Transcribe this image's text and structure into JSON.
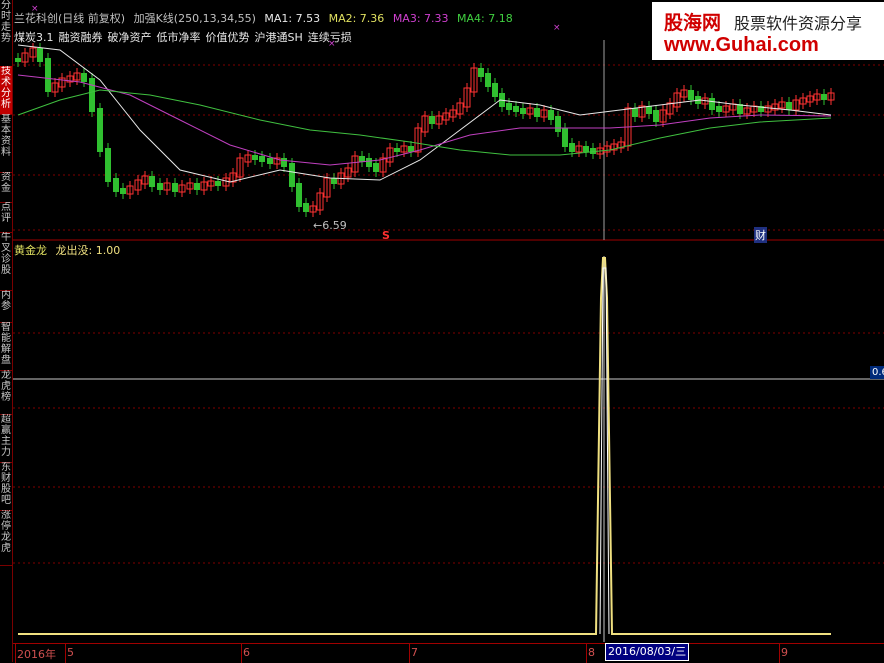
{
  "side_tabs": [
    {
      "label": "分时走势",
      "active": false
    },
    {
      "label": "技术分析",
      "active": true
    },
    {
      "label": "基本资料",
      "active": false
    },
    {
      "label": "资金",
      "active": false
    },
    {
      "label": "点评",
      "active": false
    },
    {
      "label": "牛叉诊股",
      "active": false
    },
    {
      "label": "内参",
      "active": false
    },
    {
      "label": "智能解盘",
      "active": false
    },
    {
      "label": "龙虎榜",
      "active": false
    },
    {
      "label": "超赢主力",
      "active": false
    },
    {
      "label": "东财股吧",
      "active": false
    },
    {
      "label": "涨停龙虎",
      "active": false
    }
  ],
  "kline_header": {
    "title": "兰花科创(日线 前复权)",
    "indicator": "加强K线(250,13,34,55)",
    "ma1": "MA1: 7.53",
    "ma2": "MA2: 7.36",
    "ma3": "MA3: 7.33",
    "ma4": "MA4: 7.18"
  },
  "tags_row": [
    "煤炭3.1",
    "融资融券",
    "破净资产",
    "低市净率",
    "价值优势",
    "沪港通SH",
    "连续亏损"
  ],
  "price_annotation": "6.59",
  "markers": {
    "s_marker": "S",
    "cai_marker": "财"
  },
  "indicator_header": {
    "name": "黄金龙",
    "value": "龙出没: 1.00"
  },
  "x_axis": [
    {
      "label": "2016年"
    },
    {
      "label": "5"
    },
    {
      "label": "6"
    },
    {
      "label": "7"
    },
    {
      "label": "8"
    },
    {
      "label": "9"
    }
  ],
  "cursor_date": "2016/08/03/三",
  "cursor_value_tag": "0.6",
  "logo": {
    "main": "股海网",
    "sub": "股票软件资源分享",
    "url": "www.Guhai.com"
  },
  "colors": {
    "up": "#ff3232",
    "down": "#00e0e0",
    "green": "#30c030",
    "ma_white": "#e8e8e8",
    "ma_yellow": "#e0e060",
    "ma_magenta": "#c040c0",
    "ma_green": "#40c040",
    "indicator": "#f0e080",
    "grid": "#800000"
  },
  "indicator_chart": {
    "baseline_value": 0.0,
    "peak_value": 1.0,
    "peak_date": "2016/08/03"
  }
}
